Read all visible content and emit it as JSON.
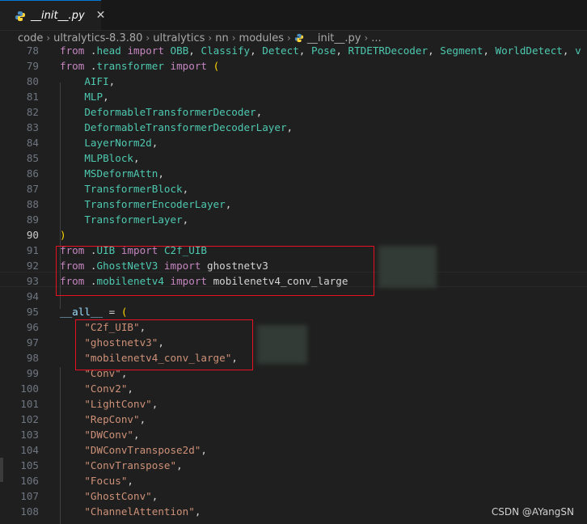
{
  "tab": {
    "label": "__init__.py",
    "close": "✕"
  },
  "breadcrumb": {
    "items": [
      "code",
      "ultralytics-8.3.80",
      "ultralytics",
      "nn",
      "modules",
      "__init__.py",
      "..."
    ]
  },
  "lines": [
    {
      "n": "78",
      "parts": [
        [
          "kw",
          "from "
        ],
        [
          "tx",
          "."
        ],
        [
          "cls",
          "head"
        ],
        [
          "kw",
          " import "
        ],
        [
          "cls",
          "OBB"
        ],
        [
          "tx",
          ", "
        ],
        [
          "cls",
          "Classify"
        ],
        [
          "tx",
          ", "
        ],
        [
          "cls",
          "Detect"
        ],
        [
          "tx",
          ", "
        ],
        [
          "cls",
          "Pose"
        ],
        [
          "tx",
          ", "
        ],
        [
          "cls",
          "RTDETRDecoder"
        ],
        [
          "tx",
          ", "
        ],
        [
          "cls",
          "Segment"
        ],
        [
          "tx",
          ", "
        ],
        [
          "cls",
          "WorldDetect"
        ],
        [
          "tx",
          ", "
        ],
        [
          "cls",
          "v"
        ]
      ]
    },
    {
      "n": "79",
      "parts": [
        [
          "kw",
          "from "
        ],
        [
          "tx",
          "."
        ],
        [
          "cls",
          "transformer"
        ],
        [
          "kw",
          " import "
        ],
        [
          "br",
          "("
        ]
      ]
    },
    {
      "n": "80",
      "parts": [
        [
          "cls",
          "    AIFI"
        ],
        [
          "tx",
          ","
        ]
      ]
    },
    {
      "n": "81",
      "parts": [
        [
          "cls",
          "    MLP"
        ],
        [
          "tx",
          ","
        ]
      ]
    },
    {
      "n": "82",
      "parts": [
        [
          "cls",
          "    DeformableTransformerDecoder"
        ],
        [
          "tx",
          ","
        ]
      ]
    },
    {
      "n": "83",
      "parts": [
        [
          "cls",
          "    DeformableTransformerDecoderLayer"
        ],
        [
          "tx",
          ","
        ]
      ]
    },
    {
      "n": "84",
      "parts": [
        [
          "cls",
          "    LayerNorm2d"
        ],
        [
          "tx",
          ","
        ]
      ]
    },
    {
      "n": "85",
      "parts": [
        [
          "cls",
          "    MLPBlock"
        ],
        [
          "tx",
          ","
        ]
      ]
    },
    {
      "n": "86",
      "parts": [
        [
          "cls",
          "    MSDeformAttn"
        ],
        [
          "tx",
          ","
        ]
      ]
    },
    {
      "n": "87",
      "parts": [
        [
          "cls",
          "    TransformerBlock"
        ],
        [
          "tx",
          ","
        ]
      ]
    },
    {
      "n": "88",
      "parts": [
        [
          "cls",
          "    TransformerEncoderLayer"
        ],
        [
          "tx",
          ","
        ]
      ]
    },
    {
      "n": "89",
      "parts": [
        [
          "cls",
          "    TransformerLayer"
        ],
        [
          "tx",
          ","
        ]
      ]
    },
    {
      "n": "90",
      "cur": true,
      "parts": [
        [
          "br",
          ")"
        ]
      ]
    },
    {
      "n": "91",
      "parts": [
        [
          "kw",
          "from "
        ],
        [
          "tx",
          "."
        ],
        [
          "cls",
          "UIB"
        ],
        [
          "kw",
          " import "
        ],
        [
          "cls",
          "C2f_UIB"
        ]
      ]
    },
    {
      "n": "92",
      "parts": [
        [
          "kw",
          "from "
        ],
        [
          "tx",
          "."
        ],
        [
          "cls",
          "GhostNetV3"
        ],
        [
          "kw",
          " import "
        ],
        [
          "tx",
          "ghostnetv3"
        ]
      ]
    },
    {
      "n": "93",
      "parts": [
        [
          "kw",
          "from "
        ],
        [
          "tx",
          "."
        ],
        [
          "cls",
          "mobilenetv4"
        ],
        [
          "kw",
          " import "
        ],
        [
          "tx",
          "mobilenetv4_conv_large"
        ]
      ]
    },
    {
      "n": "94",
      "parts": []
    },
    {
      "n": "95",
      "parts": [
        [
          "var",
          "__all__"
        ],
        [
          "tx",
          " = "
        ],
        [
          "br",
          "("
        ]
      ]
    },
    {
      "n": "96",
      "parts": [
        [
          "str",
          "    \"C2f_UIB\""
        ],
        [
          "tx",
          ","
        ]
      ]
    },
    {
      "n": "97",
      "parts": [
        [
          "str",
          "    \"ghostnetv3\""
        ],
        [
          "tx",
          ","
        ]
      ]
    },
    {
      "n": "98",
      "parts": [
        [
          "str",
          "    \"mobilenetv4_conv_large\""
        ],
        [
          "tx",
          ","
        ]
      ]
    },
    {
      "n": "99",
      "parts": [
        [
          "str",
          "    \"Conv\""
        ],
        [
          "tx",
          ","
        ]
      ]
    },
    {
      "n": "100",
      "parts": [
        [
          "str",
          "    \"Conv2\""
        ],
        [
          "tx",
          ","
        ]
      ]
    },
    {
      "n": "101",
      "parts": [
        [
          "str",
          "    \"LightConv\""
        ],
        [
          "tx",
          ","
        ]
      ]
    },
    {
      "n": "102",
      "parts": [
        [
          "str",
          "    \"RepConv\""
        ],
        [
          "tx",
          ","
        ]
      ]
    },
    {
      "n": "103",
      "parts": [
        [
          "str",
          "    \"DWConv\""
        ],
        [
          "tx",
          ","
        ]
      ]
    },
    {
      "n": "104",
      "parts": [
        [
          "str",
          "    \"DWConvTranspose2d\""
        ],
        [
          "tx",
          ","
        ]
      ]
    },
    {
      "n": "105",
      "parts": [
        [
          "str",
          "    \"ConvTranspose\""
        ],
        [
          "tx",
          ","
        ]
      ]
    },
    {
      "n": "106",
      "parts": [
        [
          "str",
          "    \"Focus\""
        ],
        [
          "tx",
          ","
        ]
      ]
    },
    {
      "n": "107",
      "parts": [
        [
          "str",
          "    \"GhostConv\""
        ],
        [
          "tx",
          ","
        ]
      ]
    },
    {
      "n": "108",
      "parts": [
        [
          "str",
          "    \"ChannelAttention\""
        ],
        [
          "tx",
          ","
        ]
      ]
    }
  ],
  "watermark": "CSDN @AYangSN",
  "colors": {
    "accent": "#0078d4",
    "highlight_box": "#e81123",
    "keyword": "#c586c0",
    "class": "#4ec9b0",
    "string": "#ce9178"
  },
  "icons": {
    "tab_file": "python-file-icon",
    "breadcrumb_file": "python-file-icon"
  }
}
